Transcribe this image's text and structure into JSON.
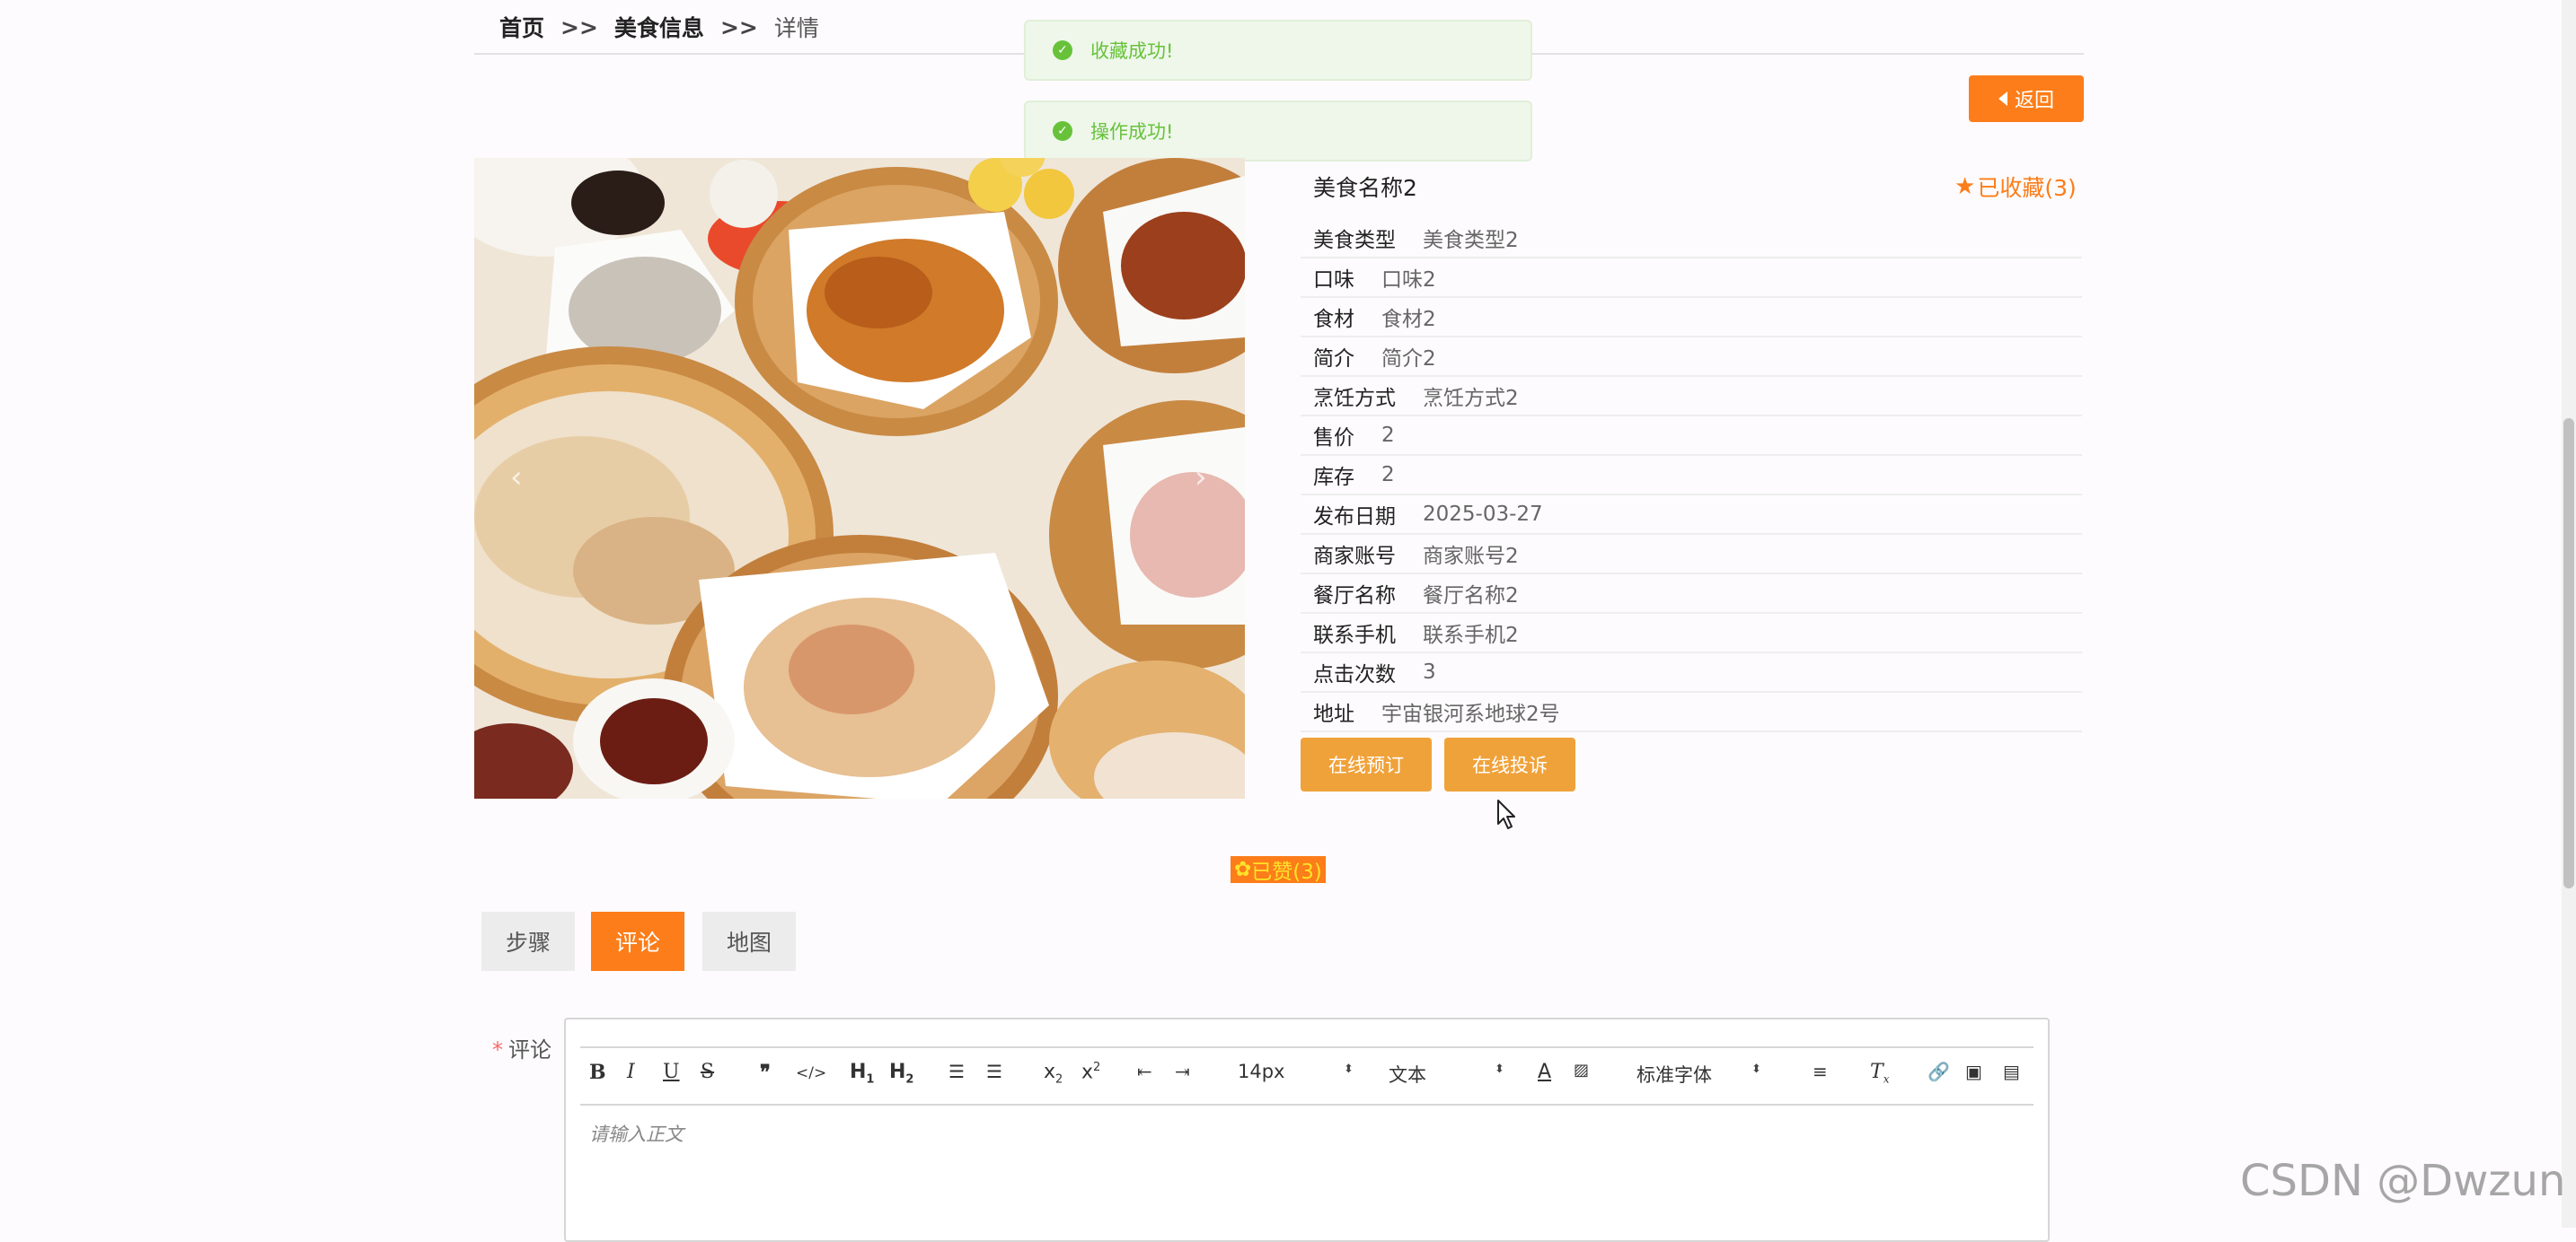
{
  "breadcrumb": {
    "home": "首页",
    "sep": ">>",
    "category": "美食信息",
    "current": "详情"
  },
  "toasts": [
    "收藏成功!",
    "操作成功!"
  ],
  "back_label": "返回",
  "detail": {
    "name": "美食名称2",
    "favorite_label": "已收藏(3)",
    "rows": [
      {
        "label": "美食类型",
        "value": "美食类型2"
      },
      {
        "label": "口味",
        "value": "口味2"
      },
      {
        "label": "食材",
        "value": "食材2"
      },
      {
        "label": "简介",
        "value": "简介2"
      },
      {
        "label": "烹饪方式",
        "value": "烹饪方式2"
      },
      {
        "label": "售价",
        "value": "2"
      },
      {
        "label": "库存",
        "value": "2"
      },
      {
        "label": "发布日期",
        "value": "2025-03-27"
      },
      {
        "label": "商家账号",
        "value": "商家账号2"
      },
      {
        "label": "餐厅名称",
        "value": "餐厅名称2"
      },
      {
        "label": "联系手机",
        "value": "联系手机2"
      },
      {
        "label": "点击次数",
        "value": "3"
      },
      {
        "label": "地址",
        "value": "宇宙银河系地球2号"
      }
    ]
  },
  "actions": {
    "order": "在线预订",
    "complaint": "在线投诉"
  },
  "like_label": "已赞(3)",
  "carousel": {
    "prev": "‹",
    "next": "›"
  },
  "tabs": [
    "步骤",
    "评论",
    "地图"
  ],
  "comment": {
    "required_mark": "*",
    "label": "评论",
    "placeholder": "请输入正文",
    "font_size": "14px",
    "text_type": "文本",
    "font_family": "标准字体"
  },
  "colors": {
    "accent": "#fc7d19",
    "action": "#f0a23a",
    "success": "#67c23a"
  },
  "watermark": "CSDN @Dwzun"
}
